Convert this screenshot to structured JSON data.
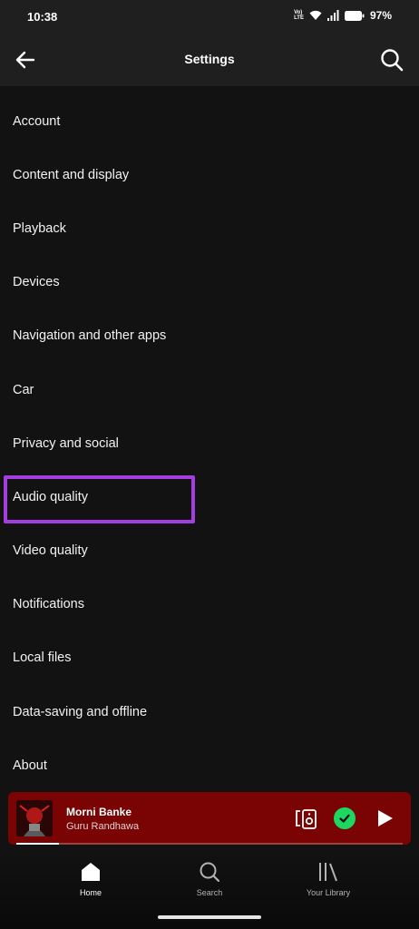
{
  "status_bar": {
    "time": "10:38",
    "volte_top": "Vo)",
    "volte_bottom": "LTE",
    "battery": "97%"
  },
  "header": {
    "title": "Settings"
  },
  "menu": {
    "items": [
      "Account",
      "Content and display",
      "Playback",
      "Devices",
      "Navigation and other apps",
      "Car",
      "Privacy and social",
      "Audio quality",
      "Video quality",
      "Notifications",
      "Local files",
      "Data-saving and offline",
      "About"
    ],
    "highlighted_index": 7,
    "highlight_color": "#a33ee0"
  },
  "mini_player": {
    "track_title": "Morni Banke",
    "artist": "Guru Randhawa",
    "background_color": "#7a0404",
    "liked_color": "#1ed760",
    "progress": 0.11
  },
  "bottom_nav": {
    "items": [
      {
        "label": "Home",
        "icon": "home-icon",
        "active": true
      },
      {
        "label": "Search",
        "icon": "search-icon",
        "active": false
      },
      {
        "label": "Your Library",
        "icon": "library-icon",
        "active": false
      }
    ]
  }
}
